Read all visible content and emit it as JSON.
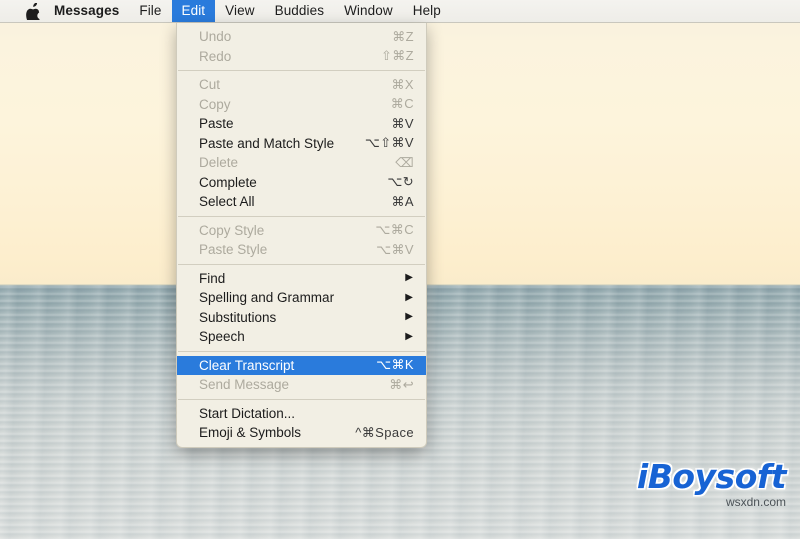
{
  "desktop": {
    "wallpaper_description": "ocean horizon with cream sky",
    "sky_color": "#fdf2d8",
    "sea_color": "#a6b5b6"
  },
  "menubar": {
    "apple_icon": "apple-logo-icon",
    "items": [
      {
        "label": "Messages",
        "bold": true,
        "active": false
      },
      {
        "label": "File",
        "bold": false,
        "active": false
      },
      {
        "label": "Edit",
        "bold": false,
        "active": true
      },
      {
        "label": "View",
        "bold": false,
        "active": false
      },
      {
        "label": "Buddies",
        "bold": false,
        "active": false
      },
      {
        "label": "Window",
        "bold": false,
        "active": false
      },
      {
        "label": "Help",
        "bold": false,
        "active": false
      }
    ],
    "highlight_color": "#2a7bdc"
  },
  "edit_menu": {
    "open": true,
    "selected_item": "Clear Transcript",
    "highlight_color": "#2a7bdc",
    "background_color": "#f2efe4",
    "groups": [
      {
        "items": [
          {
            "label": "Undo",
            "keys": "⌘Z",
            "disabled": true,
            "submenu": false
          },
          {
            "label": "Redo",
            "keys": "⇧⌘Z",
            "disabled": true,
            "submenu": false
          }
        ]
      },
      {
        "items": [
          {
            "label": "Cut",
            "keys": "⌘X",
            "disabled": true,
            "submenu": false
          },
          {
            "label": "Copy",
            "keys": "⌘C",
            "disabled": true,
            "submenu": false
          },
          {
            "label": "Paste",
            "keys": "⌘V",
            "disabled": false,
            "submenu": false
          },
          {
            "label": "Paste and Match Style",
            "keys": "⌥⇧⌘V",
            "disabled": false,
            "submenu": false
          },
          {
            "label": "Delete",
            "keys": "⌫",
            "disabled": true,
            "submenu": false
          },
          {
            "label": "Complete",
            "keys": "⌥↻",
            "disabled": false,
            "submenu": false
          },
          {
            "label": "Select All",
            "keys": "⌘A",
            "disabled": false,
            "submenu": false
          }
        ]
      },
      {
        "items": [
          {
            "label": "Copy Style",
            "keys": "⌥⌘C",
            "disabled": true,
            "submenu": false
          },
          {
            "label": "Paste Style",
            "keys": "⌥⌘V",
            "disabled": true,
            "submenu": false
          }
        ]
      },
      {
        "items": [
          {
            "label": "Find",
            "keys": "",
            "disabled": false,
            "submenu": true
          },
          {
            "label": "Spelling and Grammar",
            "keys": "",
            "disabled": false,
            "submenu": true
          },
          {
            "label": "Substitutions",
            "keys": "",
            "disabled": false,
            "submenu": true
          },
          {
            "label": "Speech",
            "keys": "",
            "disabled": false,
            "submenu": true
          }
        ]
      },
      {
        "items": [
          {
            "label": "Clear Transcript",
            "keys": "⌥⌘K",
            "disabled": false,
            "selected": true,
            "submenu": false
          },
          {
            "label": "Send Message",
            "keys": "⌘↩",
            "disabled": true,
            "submenu": false
          }
        ]
      },
      {
        "items": [
          {
            "label": "Start Dictation...",
            "keys": "",
            "disabled": false,
            "submenu": false
          },
          {
            "label": "Emoji & Symbols",
            "keys": "^⌘Space",
            "disabled": false,
            "submenu": false
          }
        ]
      }
    ]
  },
  "watermark": {
    "brand": "iBoysoft",
    "brand_color": "#1763d4",
    "subtitle": "wsxdn.com"
  }
}
